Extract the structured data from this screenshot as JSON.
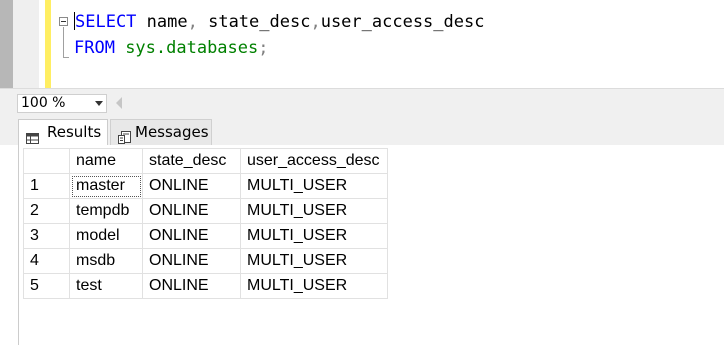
{
  "editor": {
    "line1": {
      "kw": "SELECT",
      "rest_a": " name",
      "comma1": ",",
      "rest_b": " state_desc",
      "comma2": ",",
      "rest_c": "user_access_desc"
    },
    "line2": {
      "kw": "FROM",
      "obj": " sys.databases",
      "semi": ";"
    }
  },
  "zoom": {
    "value": "100 %"
  },
  "tabs": [
    {
      "label": "Results",
      "icon": "grid-icon"
    },
    {
      "label": "Messages",
      "icon": "messages-icon"
    }
  ],
  "grid": {
    "columns": [
      "name",
      "state_desc",
      "user_access_desc"
    ],
    "rows": [
      {
        "n": "1",
        "name": "master",
        "state": "ONLINE",
        "access": "MULTI_USER"
      },
      {
        "n": "2",
        "name": "tempdb",
        "state": "ONLINE",
        "access": "MULTI_USER"
      },
      {
        "n": "3",
        "name": "model",
        "state": "ONLINE",
        "access": "MULTI_USER"
      },
      {
        "n": "4",
        "name": "msdb",
        "state": "ONLINE",
        "access": "MULTI_USER"
      },
      {
        "n": "5",
        "name": "test",
        "state": "ONLINE",
        "access": "MULTI_USER"
      }
    ]
  },
  "colors": {
    "keyword": "#0000ff",
    "function": "#008000",
    "punctuation": "#808080",
    "change_bar": "#ffee62"
  }
}
